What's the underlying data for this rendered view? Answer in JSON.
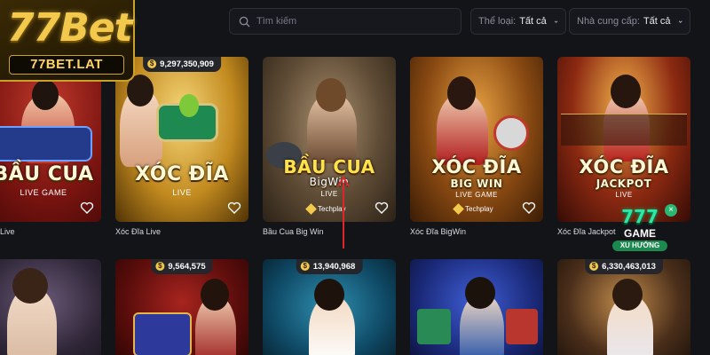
{
  "logo": {
    "main": "77Bet",
    "sub": "77BET.LAT"
  },
  "search": {
    "placeholder": "Tìm kiếm"
  },
  "filters": [
    {
      "label": "Thể loại:",
      "value": "Tất cả"
    },
    {
      "label": "Nhà cung cấp:",
      "value": "Tất cả"
    }
  ],
  "row1": [
    {
      "title": "BẦU CUA",
      "subtitle": "LIVE GAME",
      "caption": "Live",
      "jackpot": ""
    },
    {
      "title": "XÓC ĐĨA",
      "subtitle": "LIVE",
      "caption": "Xóc Đĩa Live",
      "jackpot": "9,297,350,909"
    },
    {
      "title": "BẦU CUA",
      "title2": "BigWin",
      "subtitle": "LIVE",
      "caption": "Bầu Cua Big Win",
      "provider": "Techplay",
      "jackpot": ""
    },
    {
      "title": "XÓC ĐĨA",
      "title2": "BIG WIN",
      "subtitle": "LIVE GAME",
      "caption": "Xóc Đĩa BigWin",
      "provider": "Techplay",
      "jackpot": ""
    },
    {
      "title": "XÓC ĐĨA",
      "title2": "JACKPOT",
      "subtitle": "LIVE",
      "caption": "Xóc Đĩa Jackpot",
      "jackpot": ""
    }
  ],
  "row2": [
    {
      "jackpot": ""
    },
    {
      "jackpot": "9,564,575"
    },
    {
      "jackpot": "13,940,968"
    },
    {
      "jackpot": ""
    },
    {
      "jackpot": "6,330,463,013"
    }
  ],
  "badge": {
    "number": "777",
    "line1": "GAME",
    "line2": "XU HƯỚNG",
    "close": "×"
  },
  "colors": {
    "background": "#131418",
    "accent": "#f2c94c",
    "card_border": "#2b2e36"
  }
}
